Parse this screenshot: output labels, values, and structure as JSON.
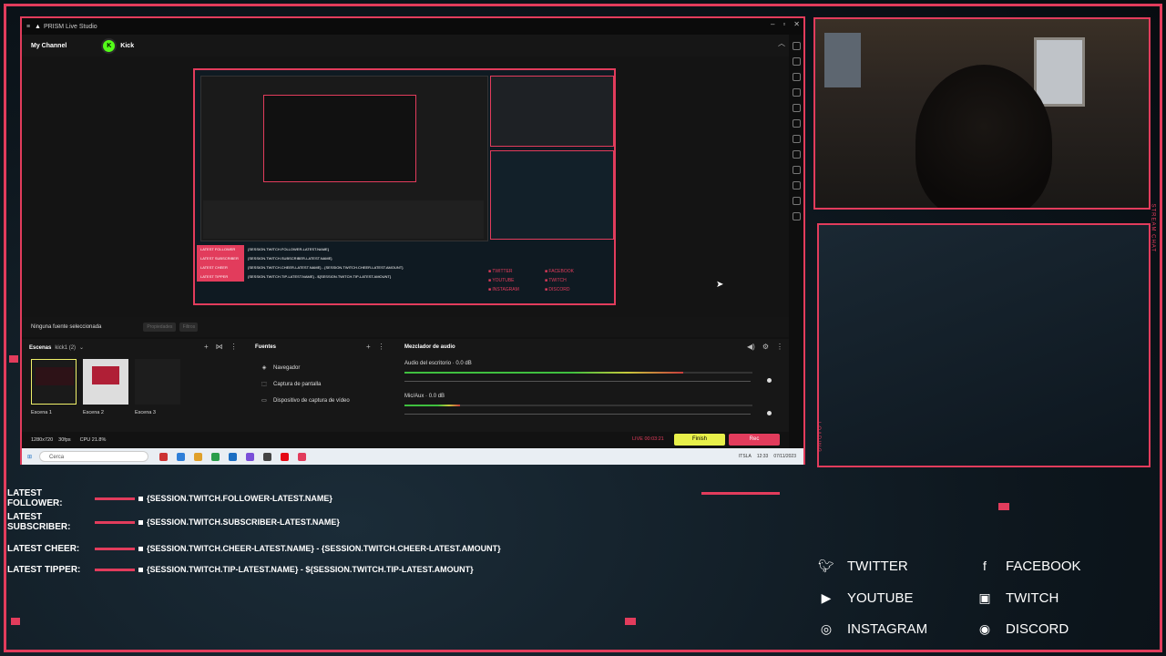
{
  "app": {
    "title": "PRISM Live Studio",
    "channel_tab": "My Channel",
    "platform_label": "Kick",
    "platform_initial": "K"
  },
  "preview": {
    "mini_rows": [
      {
        "label": "LATEST FOLLOWER",
        "value": "{SESSION.TWITCH.FOLLOWER-LATEST.NAME}"
      },
      {
        "label": "LATEST SUBSCRIBER",
        "value": "{SESSION.TWITCH.SUBSCRIBER-LATEST.NAME}"
      },
      {
        "label": "LATEST CHEER",
        "value": "{SESSION.TWITCH.CHEER-LATEST.NAME} - {SESSION.TWITCH.CHEER-LATEST.AMOUNT}"
      },
      {
        "label": "LATEST TIPPER",
        "value": "{SESSION.TWITCH.TIP-LATEST.NAME} - ${SESSION.TWITCH.TIP-LATEST.AMOUNT}"
      }
    ],
    "mini_social": [
      "TWITTER",
      "FACEBOOK",
      "YOUTUBE",
      "TWITCH",
      "INSTAGRAM",
      "DISCORD"
    ]
  },
  "source_bar": {
    "label": "Ninguna fuente seleccionada",
    "btn1": "Propiedades",
    "btn2": "Filtros"
  },
  "scenes": {
    "title": "Escenas",
    "collection": "kick1 (2)",
    "items": [
      "Escena 1",
      "Escena 2",
      "Escena 3"
    ]
  },
  "sources": {
    "title": "Fuentes",
    "items": [
      "Navegador",
      "Captura de pantalla",
      "Dispositivo de captura de vídeo"
    ]
  },
  "mixer": {
    "title": "Mezclador de audio",
    "channels": [
      {
        "name": "Audio del escritorio",
        "level": "0.0 dB",
        "meter": 0.8
      },
      {
        "name": "Mic/Aux",
        "level": "0.0 dB",
        "meter": 0.16
      }
    ]
  },
  "status": {
    "resolution": "1280x720",
    "fps": "30fps",
    "cpu": "CPU 21.8%",
    "live_time": "LIVE 00:03:21",
    "finish": "Finish",
    "rec": "Rec"
  },
  "taskbar": {
    "search": "Cerca",
    "tray": [
      "ITSLA",
      "12:33",
      "07/11/2023"
    ]
  },
  "chat": {
    "title": "STREAM CHAT",
    "loading": "LOADING..."
  },
  "overlay": {
    "rows": [
      {
        "label": "LATEST FOLLOWER:",
        "value": "{SESSION.TWITCH.FOLLOWER-LATEST.NAME}"
      },
      {
        "label": "LATEST SUBSCRIBER:",
        "value": "{SESSION.TWITCH.SUBSCRIBER-LATEST.NAME}"
      },
      {
        "label": "LATEST CHEER:",
        "value": "{SESSION.TWITCH.CHEER-LATEST.NAME} - {SESSION.TWITCH.CHEER-LATEST.AMOUNT}"
      },
      {
        "label": "LATEST TIPPER:",
        "value": "{SESSION.TWITCH.TIP-LATEST.NAME} - ${SESSION.TWITCH.TIP-LATEST.AMOUNT}"
      }
    ],
    "social": [
      {
        "name": "TWITTER",
        "icon": "twitter-icon"
      },
      {
        "name": "FACEBOOK",
        "icon": "facebook-icon"
      },
      {
        "name": "YOUTUBE",
        "icon": "youtube-icon"
      },
      {
        "name": "TWITCH",
        "icon": "twitch-icon"
      },
      {
        "name": "INSTAGRAM",
        "icon": "instagram-icon"
      },
      {
        "name": "DISCORD",
        "icon": "discord-icon"
      }
    ]
  },
  "colors": {
    "accent": "#e23c5c",
    "finish": "#e8f04a",
    "meter": "#3fbf3f"
  }
}
